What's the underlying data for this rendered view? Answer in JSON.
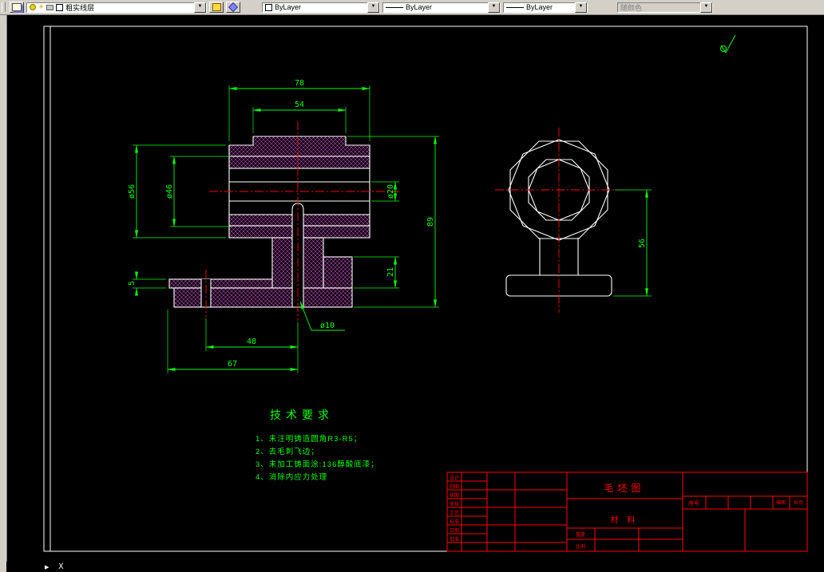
{
  "toolbar": {
    "layer": {
      "value": "粗实线层"
    },
    "color": {
      "value": "ByLayer"
    },
    "linetype": {
      "value": "ByLayer"
    },
    "lineweight": {
      "value": "ByLayer"
    },
    "plotstyle": {
      "value": "随颜色"
    }
  },
  "statusbar": {
    "coord": "X"
  },
  "drawing": {
    "front_view": {
      "dims": {
        "d78": "78",
        "d54": "54",
        "d56": "ø56",
        "d46": "ø46",
        "d20": "ø20",
        "d89": "89",
        "d21": "21",
        "d5": "5",
        "d10": "ø10",
        "d48": "48",
        "d67": "67"
      }
    },
    "side_view": {
      "dims": {
        "d56": "56"
      }
    },
    "tech": {
      "title": "技术要求",
      "items": [
        "1、未注明铸造圆角R3-R5；",
        "2、去毛刺飞边；",
        "3、未加工铸面涂:136醇酸底漆；",
        "4、消除内应力处理"
      ]
    },
    "titleblock": {
      "name": "毛坯图",
      "material": "材 料",
      "serial": "序号",
      "tracing": "描图",
      "pages": "共页",
      "weight": "重量",
      "scale": "比例",
      "rows": [
        "设计",
        "制图",
        "描图",
        "审核",
        "工艺",
        "标准",
        "日期",
        "批准"
      ]
    },
    "colors": {
      "dimension": "#00ff00",
      "centerline": "#ff0000",
      "object": "#ffffff",
      "hatch": "#c44fc4",
      "titleblock": "#ff0000",
      "background": "#000000"
    }
  }
}
